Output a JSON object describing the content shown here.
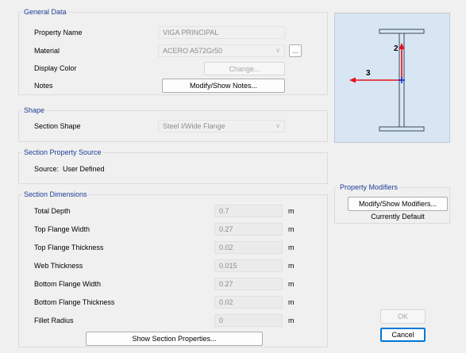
{
  "general": {
    "title": "General Data",
    "property_name_label": "Property Name",
    "property_name_value": "VIGA PRINCIPAL",
    "material_label": "Material",
    "material_value": "ACERO A572Gr50",
    "material_more": "...",
    "display_color_label": "Display Color",
    "change_button": "Change...",
    "notes_label": "Notes",
    "notes_button": "Modify/Show Notes..."
  },
  "shape": {
    "title": "Shape",
    "section_shape_label": "Section Shape",
    "section_shape_value": "Steel I/Wide Flange"
  },
  "source": {
    "title": "Section Property Source",
    "text": "Source:  User Defined"
  },
  "dimensions": {
    "title": "Section Dimensions",
    "rows": [
      {
        "label": "Total Depth",
        "value": "0.7",
        "unit": "m"
      },
      {
        "label": "Top Flange Width",
        "value": "0.27",
        "unit": "m"
      },
      {
        "label": "Top Flange Thickness",
        "value": "0.02",
        "unit": "m"
      },
      {
        "label": "Web Thickness",
        "value": "0.015",
        "unit": "m"
      },
      {
        "label": "Bottom Flange Width",
        "value": "0.27",
        "unit": "m"
      },
      {
        "label": "Bottom Flange Thickness",
        "value": "0.02",
        "unit": "m"
      },
      {
        "label": "Fillet Radius",
        "value": "0",
        "unit": "m"
      }
    ],
    "show_properties_button": "Show Section Properties..."
  },
  "preview": {
    "axis_2_label": "2",
    "axis_3_label": "3",
    "axis_color": "#e8101a",
    "centroid_color": "#1a2bd8"
  },
  "modifiers": {
    "title": "Property Modifiers",
    "button": "Modify/Show Modifiers...",
    "status": "Currently Default"
  },
  "dialog": {
    "ok_button": "OK",
    "cancel_button": "Cancel"
  }
}
